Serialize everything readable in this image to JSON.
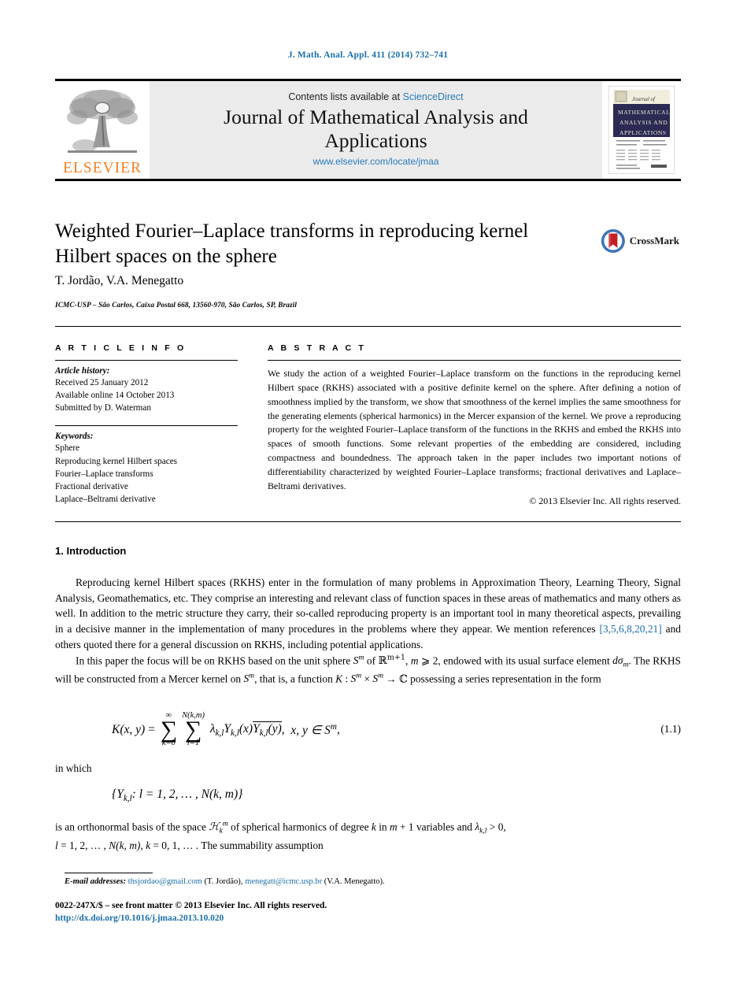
{
  "journal_ref": "J. Math. Anal. Appl. 411 (2014) 732–741",
  "masthead": {
    "contents_prefix": "Contents lists available at ",
    "sciencedirect": "ScienceDirect",
    "journal_name_line1": "Journal of Mathematical Analysis and",
    "journal_name_line2": "Applications",
    "journal_url": "www.elsevier.com/locate/jmaa",
    "publisher_logo_word": "ELSEVIER",
    "publisher_logo_icon": "elsevier-tree-icon",
    "cover_icon": "journal-cover-thumbnail",
    "cover_title_line1": "Journal of",
    "cover_title_line2": "MATHEMATICAL",
    "cover_title_line3": "ANALYSIS AND",
    "cover_title_line4": "APPLICATIONS"
  },
  "article": {
    "title": "Weighted Fourier–Laplace transforms in reproducing kernel Hilbert spaces on the sphere",
    "authors": "T. Jordão, V.A. Menegatto",
    "affiliation": "ICMC-USP – São Carlos, Caixa Postal 668, 13560-970, São Carlos, SP, Brazil",
    "crossmark_label": "CrossMark",
    "crossmark_icon": "crossmark-badge-icon"
  },
  "info": {
    "heading": "A R T I C L E   I N F O",
    "history_label": "Article history:",
    "history": [
      "Received 25 January 2012",
      "Available online 14 October 2013",
      "Submitted by D. Waterman"
    ],
    "keywords_label": "Keywords:",
    "keywords": [
      "Sphere",
      "Reproducing kernel Hilbert spaces",
      "Fourier–Laplace transforms",
      "Fractional derivative",
      "Laplace–Beltrami derivative"
    ]
  },
  "abstract": {
    "heading": "A B S T R A C T",
    "text": "We study the action of a weighted Fourier–Laplace transform on the functions in the reproducing kernel Hilbert space (RKHS) associated with a positive definite kernel on the sphere. After defining a notion of smoothness implied by the transform, we show that smoothness of the kernel implies the same smoothness for the generating elements (spherical harmonics) in the Mercer expansion of the kernel. We prove a reproducing property for the weighted Fourier–Laplace transform of the functions in the RKHS and embed the RKHS into spaces of smooth functions. Some relevant properties of the embedding are considered, including compactness and boundedness. The approach taken in the paper includes two important notions of differentiability characterized by weighted Fourier–Laplace transforms; fractional derivatives and Laplace–Beltrami derivatives.",
    "copyright": "© 2013 Elsevier Inc. All rights reserved."
  },
  "body": {
    "section_heading": "1. Introduction",
    "para1_a": "Reproducing kernel Hilbert spaces (RKHS) enter in the formulation of many problems in Approximation Theory, Learning Theory, Signal Analysis, Geomathematics, etc. They comprise an interesting and relevant class of function spaces in these areas of mathematics and many others as well. In addition to the metric structure they carry, their so-called reproducing property is an important tool in many theoretical aspects, prevailing in a decisive manner in the implementation of many procedures in the problems where they appear. We mention references ",
    "citation": "[3,5,6,8,20,21]",
    "para1_b": " and others quoted there for a general discussion on RKHS, including potential applications.",
    "para2_a": "In this paper the focus will be on RKHS based on the unit sphere ",
    "para2_b": " of ",
    "para2_c": ", ",
    "para2_d": ", endowed with its usual surface element ",
    "para2_e": ". The RKHS will be constructed from a Mercer kernel on ",
    "para2_f": ", that is, a function ",
    "para2_g": " possessing a series representation in the form",
    "in_which": "in which",
    "after_set_line1_a": "is an orthonormal basis of the space ",
    "after_set_line1_b": " of spherical harmonics of degree ",
    "after_set_line1_c": " in ",
    "after_set_line1_d": " variables and ",
    "after_set_line2": "The summability assumption"
  },
  "equation": {
    "number": "(1.1)",
    "kernel": "K",
    "sum1_upper": "∞",
    "sum1_lower": "k=0",
    "sum2_upper": "N(k,m)",
    "sum2_lower": "l=1"
  },
  "footer": {
    "email_label": "E-mail addresses:",
    "email1": "thsjordao@gmail.com",
    "email1_owner": "(T. Jordão),",
    "email2": "menegatt@icmc.usp.br",
    "email2_owner": "(V.A. Menegatto).",
    "issn_line": "0022-247X/$ – see front matter © 2013 Elsevier Inc. All rights reserved.",
    "doi": "http://dx.doi.org/10.1016/j.jmaa.2013.10.020"
  },
  "colors": {
    "link": "#1a6ea8",
    "elsevier_orange": "#f28021",
    "masthead_bg": "#ebebeb",
    "cover_navy": "#2b2a52"
  }
}
